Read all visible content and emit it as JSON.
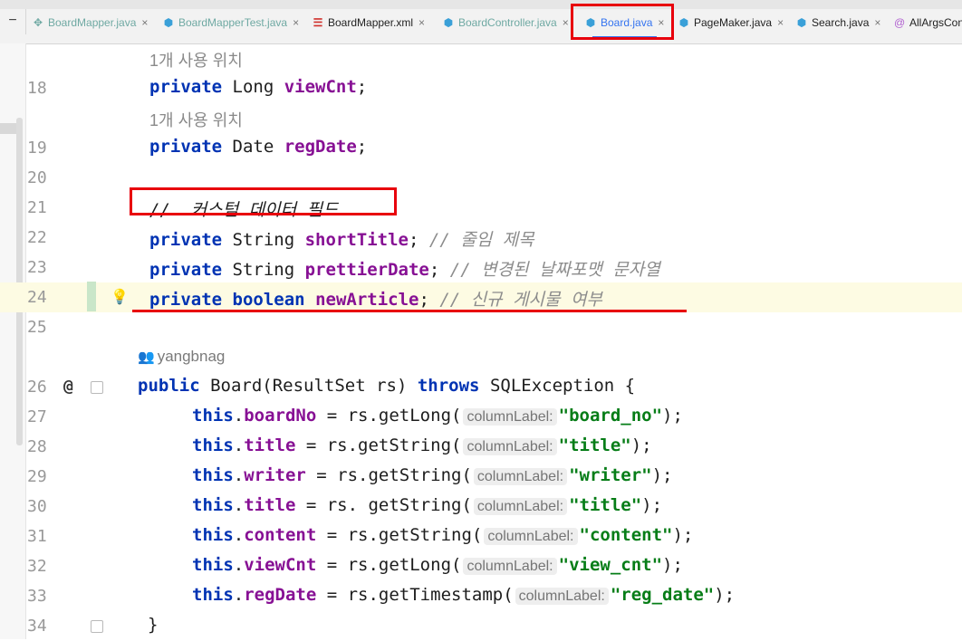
{
  "tabs": [
    {
      "label": "BoardMapper.java",
      "icon": "class-icon",
      "faded": true
    },
    {
      "label": "BoardMapperTest.java",
      "icon": "class-icon",
      "faded": true
    },
    {
      "label": "BoardMapper.xml",
      "icon": "xml-icon",
      "faded": false
    },
    {
      "label": "BoardController.java",
      "icon": "class-icon",
      "faded": true
    },
    {
      "label": "Board.java",
      "icon": "class-icon",
      "faded": false,
      "active": true
    },
    {
      "label": "PageMaker.java",
      "icon": "class-icon",
      "faded": false
    },
    {
      "label": "Search.java",
      "icon": "class-icon",
      "faded": false
    },
    {
      "label": "AllArgsCon",
      "icon": "annotation-icon",
      "faded": false
    }
  ],
  "editor": {
    "usage_label": "1개 사용 위치",
    "author": "yangbnag",
    "lines": {
      "l18": {
        "num": "18",
        "p1": "private",
        "p2": " Long ",
        "f": "viewCnt",
        "p3": ";"
      },
      "l19": {
        "num": "19",
        "p1": "private",
        "p2": " Date ",
        "f": "regDate",
        "p3": ";"
      },
      "l20": {
        "num": "20"
      },
      "l21": {
        "num": "21",
        "comment": "//  커스텀 데이터 필드"
      },
      "l22": {
        "num": "22",
        "p1": "private",
        "p2": " String ",
        "f": "shortTitle",
        "p3": "; ",
        "comment": "// 줄임 제목"
      },
      "l23": {
        "num": "23",
        "p1": "private",
        "p2": " String ",
        "f": "prettierDate",
        "p3": "; ",
        "comment": "// 변경된 날짜포맷 문자열"
      },
      "l24": {
        "num": "24",
        "p1": "private",
        "p2": " ",
        "kw2": "boolean",
        "p2b": " ",
        "f": "newArticle",
        "p3": "; ",
        "comment": "// 신규 게시물 여부"
      },
      "l25": {
        "num": "25"
      },
      "l26": {
        "num": "26",
        "kw": "public",
        "mid": " Board(ResultSet rs) ",
        "kw2": "throws",
        "tail": " SQLException {"
      },
      "l27": {
        "num": "27",
        "field": "boardNo",
        "call": " = rs.getLong(",
        "hint": "columnLabel:",
        "str": "\"board_no\"",
        "end": ");"
      },
      "l28": {
        "num": "28",
        "field": "title",
        "call": " = rs.getString(",
        "hint": "columnLabel:",
        "str": "\"title\"",
        "end": ");"
      },
      "l29": {
        "num": "29",
        "field": "writer",
        "call": " = rs.getString(",
        "hint": "columnLabel:",
        "str": "\"writer\"",
        "end": ");"
      },
      "l30": {
        "num": "30",
        "field": "title",
        "call": " = rs. getString(",
        "hint": "columnLabel:",
        "str": "\"title\"",
        "end": ");"
      },
      "l31": {
        "num": "31",
        "field": "content",
        "call": " = rs.getString(",
        "hint": "columnLabel:",
        "str": "\"content\"",
        "end": ");"
      },
      "l32": {
        "num": "32",
        "field": "viewCnt",
        "call": " = rs.getLong(",
        "hint": "columnLabel:",
        "str": "\"view_cnt\"",
        "end": ");"
      },
      "l33": {
        "num": "33",
        "field": "regDate",
        "call": " = rs.getTimestamp(",
        "hint": "columnLabel:",
        "str": "\"reg_date\"",
        "end": ");"
      },
      "l34": {
        "num": "34",
        "brace": "}"
      }
    },
    "this_kw": "this",
    "dot": ".",
    "annotation_marker": "@"
  },
  "colors": {
    "keyword": "#0033b3",
    "field": "#871094",
    "string": "#067d17",
    "comment": "#8c8c8c",
    "highlight": "#e8000c"
  }
}
